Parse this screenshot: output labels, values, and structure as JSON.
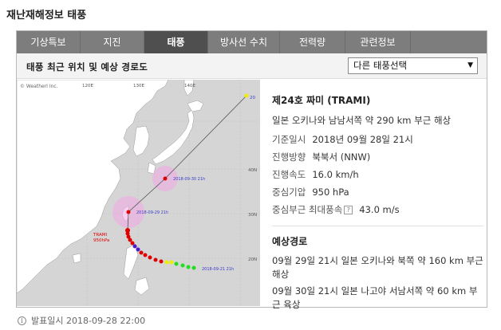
{
  "page_title": "재난재해정보 태풍",
  "tabs": [
    {
      "label": "기상특보"
    },
    {
      "label": "지진"
    },
    {
      "label": "태풍"
    },
    {
      "label": "방사선 수치"
    },
    {
      "label": "전력량"
    },
    {
      "label": "관련정보"
    }
  ],
  "active_tab": "태풍",
  "subheader": {
    "title": "태풍 최근 위치 및 예상 경로도",
    "select_value": "다른 태풍선택"
  },
  "map": {
    "credit": "© WeatherI Inc.",
    "lon_labels": [
      "120E",
      "130E",
      "140E"
    ],
    "lat_labels": [
      "40N",
      "30N",
      "20N"
    ],
    "corner_label": "20",
    "storm_label": "TRAMI",
    "storm_pressure": "950hPa",
    "forecast_labels": [
      "2018-09-30 21h",
      "2018-09-29 21h"
    ],
    "start_label": "2018-09-21 21h"
  },
  "storm": {
    "name": "제24호 짜미 (TRAMI)",
    "location": "일본 오키나와 남남서쪽 약 290 km 부근 해상",
    "details": [
      {
        "key": "기준일시",
        "value": "2018년 09월 28일 21시"
      },
      {
        "key": "진행방향",
        "value": "북북서 (NNW)"
      },
      {
        "key": "진행속도",
        "value": "16.0 km/h"
      },
      {
        "key": "중심기압",
        "value": "950 hPa"
      },
      {
        "key": "중심부근 최대풍속",
        "value": "43.0 m/s"
      }
    ],
    "help_glyph": "?"
  },
  "forecast": {
    "title": "예상경로",
    "items": [
      "09월 29일 21시 일본 오키나와 북쪽 약 160 km 부근 해상",
      "09월 30일 21시 일본 나고야 서남서쪽 약 60 km 부근 육상"
    ]
  },
  "footer": {
    "info_glyph": "i",
    "text": "발표일시 2018-09-28 22:00"
  }
}
